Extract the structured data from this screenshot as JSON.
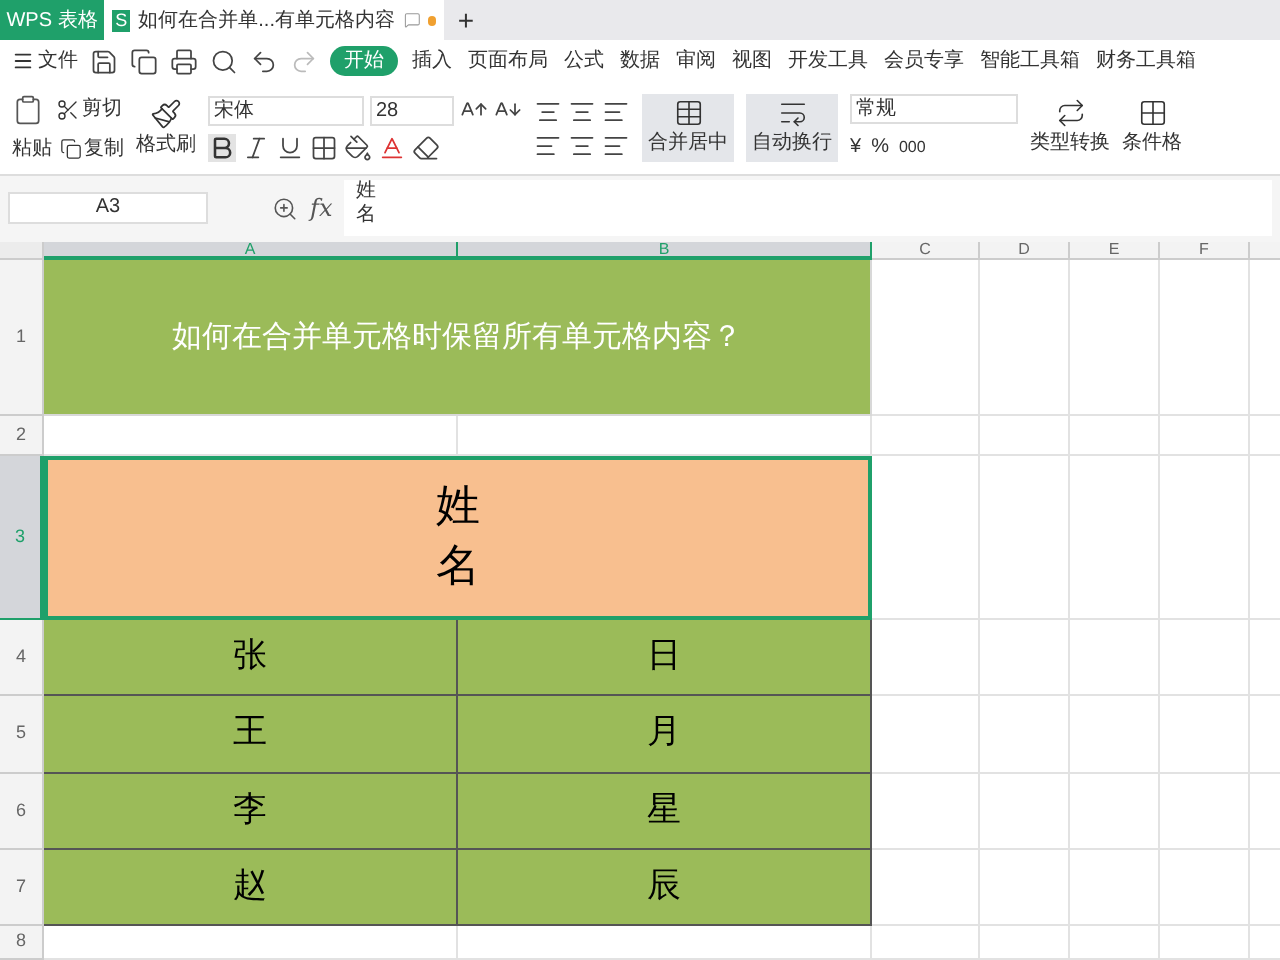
{
  "app_tab": "WPS 表格",
  "doc_tab": {
    "badge": "S",
    "title": "如何在合并单...有单元格内容",
    "selected": true
  },
  "new_tab": "+",
  "menu": {
    "file": "文件",
    "items": [
      {
        "label": "开始",
        "selected": true
      },
      {
        "label": "插入",
        "selected": false
      },
      {
        "label": "页面布局",
        "selected": false
      },
      {
        "label": "公式",
        "selected": false
      },
      {
        "label": "数据",
        "selected": false
      },
      {
        "label": "审阅",
        "selected": false
      },
      {
        "label": "视图",
        "selected": false
      },
      {
        "label": "开发工具",
        "selected": false
      },
      {
        "label": "会员专享",
        "selected": false
      },
      {
        "label": "智能工具箱",
        "selected": false
      },
      {
        "label": "财务工具箱",
        "selected": false
      }
    ]
  },
  "ribbon": {
    "paste": "粘贴",
    "cut": "剪切",
    "copy": "复制",
    "format_painter": "格式刷",
    "font_name": "宋体",
    "font_size": "28",
    "merge": {
      "label": "合并居中",
      "on": true
    },
    "wrap": {
      "label": "自动换行",
      "on": true
    },
    "number_format": "常规",
    "currency": "¥",
    "percent": "%",
    "thousands": "000",
    "convert": "类型转换",
    "conditional": "条件格"
  },
  "formula_bar": {
    "cell_ref": "A3",
    "fx": "fx",
    "value": "姓名"
  },
  "sheet": {
    "columns": [
      {
        "label": "A",
        "selected": true
      },
      {
        "label": "B",
        "selected": true
      },
      {
        "label": "C",
        "selected": false
      },
      {
        "label": "D",
        "selected": false
      },
      {
        "label": "E",
        "selected": false
      },
      {
        "label": "F",
        "selected": false
      }
    ],
    "rows": [
      {
        "header": "1",
        "kind": "title",
        "text": "如何在合并单元格时保留所有单元格内容？",
        "selected": false
      },
      {
        "header": "2",
        "kind": "empty",
        "selected": false
      },
      {
        "header": "3",
        "kind": "merged",
        "text": "姓名",
        "selected": true
      },
      {
        "header": "4",
        "kind": "pair",
        "cells": [
          "张",
          "日"
        ],
        "selected": false
      },
      {
        "header": "5",
        "kind": "pair",
        "cells": [
          "王",
          "月"
        ],
        "selected": false
      },
      {
        "header": "6",
        "kind": "pair",
        "cells": [
          "李",
          "星"
        ],
        "selected": false
      },
      {
        "header": "7",
        "kind": "pair",
        "cells": [
          "赵",
          "辰"
        ],
        "selected": false
      },
      {
        "header": "8",
        "kind": "empty",
        "selected": false
      }
    ]
  }
}
